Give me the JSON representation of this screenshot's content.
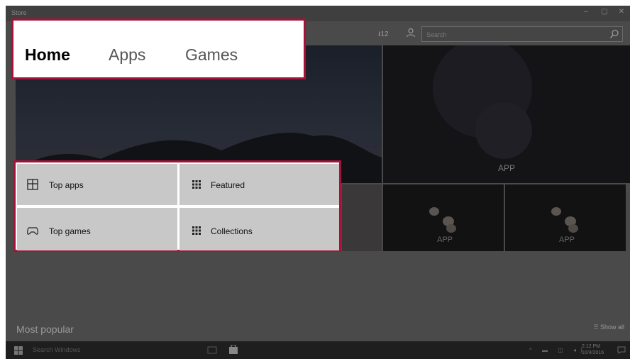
{
  "window": {
    "title": "Store",
    "controls": [
      "–",
      "▢",
      "✕"
    ]
  },
  "toolbar": {
    "downloads_count": "12",
    "search_placeholder": "Search"
  },
  "nav": {
    "tabs": [
      {
        "label": "Home",
        "active": true
      },
      {
        "label": "Apps",
        "active": false
      },
      {
        "label": "Games",
        "active": false
      }
    ]
  },
  "menu": {
    "items": [
      {
        "label": "Top apps",
        "icon": "top-apps-icon"
      },
      {
        "label": "Featured",
        "icon": "grid-icon"
      },
      {
        "label": "Top games",
        "icon": "gamepad-icon"
      },
      {
        "label": "Collections",
        "icon": "grid-icon"
      }
    ]
  },
  "tiles": {
    "labels": [
      "APP",
      "APP",
      "APP"
    ]
  },
  "sections": {
    "most_popular": "Most popular",
    "show_all": "Show all"
  },
  "taskbar": {
    "search_text": "Search Windows",
    "time": "2:12 PM",
    "date": "10/4/2016"
  },
  "colors": {
    "highlight_border": "#a5123a",
    "overlay": "#4a4a4a",
    "menu_cell": "#c8c8c8"
  }
}
